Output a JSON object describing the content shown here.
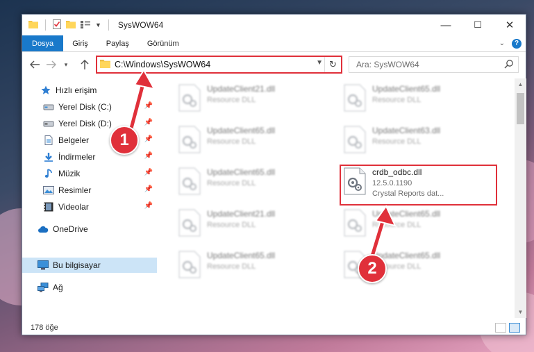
{
  "window": {
    "title": "SysWOW64",
    "controls": {
      "minimize": "—",
      "maximize": "☐",
      "close": "✕"
    }
  },
  "ribbon": {
    "tabs": [
      {
        "label": "Dosya",
        "active": true
      },
      {
        "label": "Giriş",
        "active": false
      },
      {
        "label": "Paylaş",
        "active": false
      },
      {
        "label": "Görünüm",
        "active": false
      }
    ],
    "help": "?"
  },
  "address": {
    "path": "C:\\Windows\\SysWOW64",
    "search_placeholder": "Ara: SysWOW64"
  },
  "sidebar": {
    "items": [
      {
        "label": "Hızlı erişim",
        "icon": "star-icon"
      },
      {
        "label": "Yerel Disk (C:)",
        "icon": "drive-icon",
        "pinned": true
      },
      {
        "label": "Yerel Disk (D:)",
        "icon": "drive-icon",
        "pinned": true
      },
      {
        "label": "Belgeler",
        "icon": "document-icon",
        "pinned": true
      },
      {
        "label": "İndirmeler",
        "icon": "download-icon",
        "pinned": true
      },
      {
        "label": "Müzik",
        "icon": "music-icon",
        "pinned": true
      },
      {
        "label": "Resimler",
        "icon": "pictures-icon",
        "pinned": true
      },
      {
        "label": "Videolar",
        "icon": "video-icon",
        "pinned": true
      },
      {
        "label": "OneDrive",
        "icon": "cloud-icon"
      },
      {
        "label": "Bu bilgisayar",
        "icon": "computer-icon",
        "selected": true
      },
      {
        "label": "Ağ",
        "icon": "network-icon"
      }
    ]
  },
  "files": [
    {
      "name": "UpdateClient21.dll",
      "line1": "Resource DLL",
      "line2": ""
    },
    {
      "name": "UpdateClient65.dll",
      "line1": "Resource DLL",
      "line2": ""
    },
    {
      "name": "UpdateClient65.dll",
      "line1": "Resource DLL",
      "line2": ""
    },
    {
      "name": "UpdateClient63.dll",
      "line1": "Resource DLL",
      "line2": ""
    },
    {
      "name": "UpdateClient65.dll",
      "line1": "Resource DLL",
      "line2": ""
    },
    {
      "name": "crdb_odbc.dll",
      "line1": "12.5.0.1190",
      "line2": "Crystal Reports dat..."
    },
    {
      "name": "UpdateClient21.dll",
      "line1": "Resource DLL",
      "line2": ""
    },
    {
      "name": "UpdateClient65.dll",
      "line1": "Resource DLL",
      "line2": ""
    },
    {
      "name": "UpdateClient65.dll",
      "line1": "Resource DLL",
      "line2": ""
    },
    {
      "name": "UpdateClient65.dll",
      "line1": "Resource DLL",
      "line2": ""
    }
  ],
  "status": {
    "count": "178 öğe"
  },
  "annotations": {
    "step1": "1",
    "step2": "2"
  },
  "colors": {
    "accent": "#1979ca",
    "highlight": "#e0303a",
    "selected": "#cce4f7"
  }
}
